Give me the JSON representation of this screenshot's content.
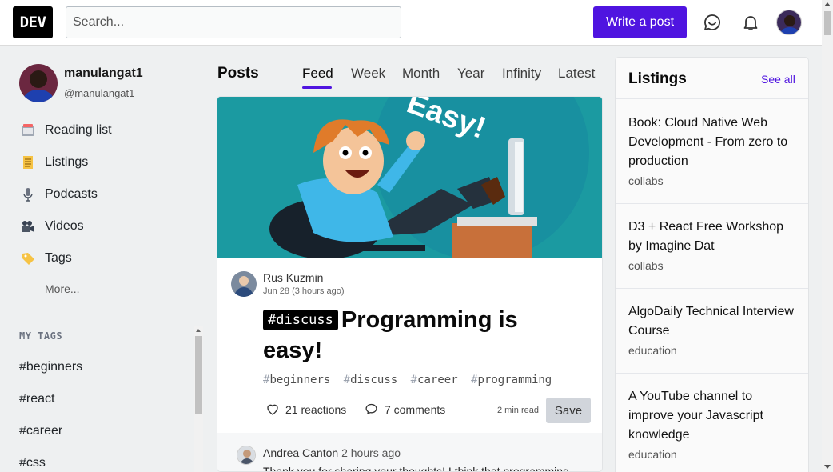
{
  "header": {
    "logo": "DEV",
    "search_placeholder": "Search...",
    "write_post_label": "Write a post",
    "icons": [
      "chat-icon",
      "bell-icon",
      "user-avatar"
    ]
  },
  "sidebar": {
    "username": "manulangat1",
    "handle": "@manulangat1",
    "nav": [
      {
        "label": "Reading list",
        "icon": "reading-list-icon"
      },
      {
        "label": "Listings",
        "icon": "listings-icon"
      },
      {
        "label": "Podcasts",
        "icon": "podcast-icon"
      },
      {
        "label": "Videos",
        "icon": "video-icon"
      },
      {
        "label": "Tags",
        "icon": "tag-icon"
      }
    ],
    "more_label": "More...",
    "my_tags_title": "MY TAGS",
    "tags": [
      "#beginners",
      "#react",
      "#career",
      "#css"
    ]
  },
  "feed": {
    "title": "Posts",
    "tabs": [
      "Feed",
      "Week",
      "Month",
      "Year",
      "Infinity",
      "Latest"
    ],
    "active_tab": "Feed",
    "post": {
      "cover_text": "Easy!",
      "author": "Rus Kuzmin",
      "date": "Jun 28 (3 hours ago)",
      "badge": "#discuss",
      "title": "Programming is easy!",
      "tags": [
        "beginners",
        "discuss",
        "career",
        "programming"
      ],
      "reactions": "21 reactions",
      "comments": "7 comments",
      "read_time": "2 min read",
      "save_label": "Save",
      "top_comment": {
        "author": "Andrea Canton",
        "time": "2 hours ago",
        "text": "Thank you for sharing your thoughts! I think that programming"
      }
    }
  },
  "listings": {
    "title": "Listings",
    "see_all": "See all",
    "items": [
      {
        "title": "Book: Cloud Native Web Development - From zero to production",
        "category": "collabs"
      },
      {
        "title": "D3 + React Free Workshop by Imagine Dat",
        "category": "collabs"
      },
      {
        "title": "AlgoDaily Technical Interview Course",
        "category": "education"
      },
      {
        "title": "A YouTube channel to improve your Javascript knowledge",
        "category": "education"
      }
    ]
  },
  "colors": {
    "accent": "#4f14e0",
    "background": "#eef0f1",
    "cover": "#1b9aa1"
  }
}
